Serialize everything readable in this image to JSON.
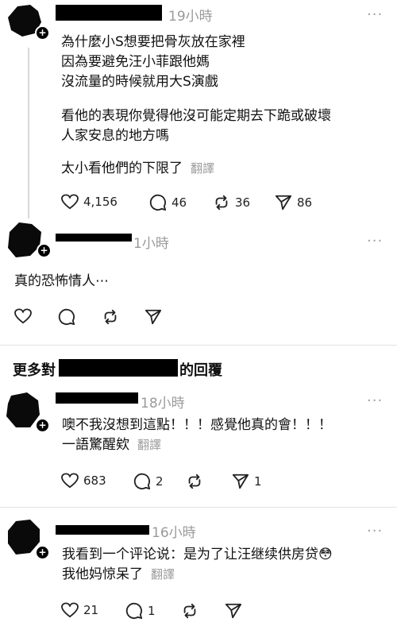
{
  "posts": [
    {
      "time": "19小時",
      "lines": [
        "為什麼小S想要把骨灰放在家裡",
        "因為要避免汪小菲跟他媽",
        "沒流量的時候就用大S演戲",
        "看他的表現你覺得他沒可能定期去下跪或破壞",
        "人家安息的地方嗎",
        "太小看他們的下限了"
      ],
      "translate": "翻譯",
      "likes": "4,156",
      "comments": "46",
      "reposts": "36",
      "shares": "86"
    },
    {
      "time": "1小時",
      "lines": [
        "真的恐怖情人⋯"
      ]
    }
  ],
  "section_title_pre": "更多對",
  "section_title_post": "的回覆",
  "replies": [
    {
      "time": "18小時",
      "lines": [
        "噢不我沒想到這點！！！感覺他真的會！！！",
        "一語驚醒欸"
      ],
      "translate": "翻譯",
      "likes": "683",
      "comments": "2",
      "shares": "1"
    },
    {
      "time": "16小時",
      "lines": [
        "我看到一个评论说：是为了让汪继续供房贷",
        "我他妈惊呆了"
      ],
      "emoji": "😳",
      "translate": "翻譯",
      "likes": "21",
      "comments": "1"
    }
  ],
  "more_label": "···",
  "icons": {
    "plus": "+"
  }
}
